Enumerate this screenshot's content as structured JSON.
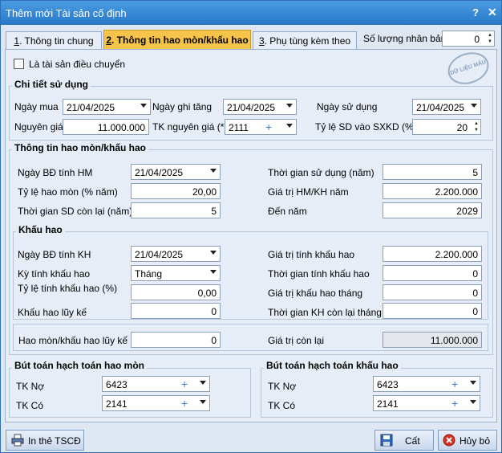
{
  "window": {
    "title": "Thêm mới Tài sản cố định",
    "help_label": "?",
    "close_label": "✕"
  },
  "tabs": [
    {
      "key": "1",
      "rest": ". Thông tin chung"
    },
    {
      "key": "2",
      "rest": ". Thông tin hao mòn/khấu hao"
    },
    {
      "key": "3",
      "rest": ". Phụ tùng kèm theo"
    }
  ],
  "copies": {
    "label": "Số lượng nhân bản",
    "value": "0"
  },
  "transfer_checkbox": {
    "label": "Là tài sản điều chuyển",
    "checked": false
  },
  "stamp": {
    "text": "DỮ LIỆU MẪU"
  },
  "usage": {
    "title": "Chi tiết sử dụng",
    "purchase_date_label": "Ngày mua",
    "purchase_date": "21/04/2025",
    "increase_date_label": "Ngày ghi tăng",
    "increase_date": "21/04/2025",
    "use_date_label": "Ngày sử dụng",
    "use_date": "21/04/2025",
    "cost_label": "Nguyên giá",
    "cost": "11.000.000",
    "cost_account_label": "TK nguyên giá (*)",
    "cost_account": "2111",
    "sxkd_ratio_label": "Tỷ lệ SD vào SXKD (%)",
    "sxkd_ratio": "20"
  },
  "depreciation": {
    "title": "Thông tin hao mòn/khấu hao",
    "hm_start_label": "Ngày BĐ tính HM",
    "hm_start": "21/04/2025",
    "hm_rate_label": "Tỷ lệ hao mòn (% năm)",
    "hm_rate": "20,00",
    "remaining_years_label": "Thời gian SD còn lại (năm)",
    "remaining_years": "5",
    "use_years_label": "Thời gian sử dụng (năm)",
    "use_years": "5",
    "hm_value_label": "Giá trị HM/KH năm",
    "hm_value": "2.200.000",
    "to_year_label": "Đến năm",
    "to_year": "2029"
  },
  "kh": {
    "title": "Khấu hao",
    "start_label": "Ngày BĐ tính KH",
    "start": "21/04/2025",
    "period_label": "Kỳ tính khấu hao",
    "period": "Tháng",
    "rate_label": "Tỷ lệ tính khấu hao (%)",
    "rate": "0,00",
    "accumulated_label": "Khấu hao lũy kế",
    "accumulated": "0",
    "base_label": "Giá trị tính khấu hao",
    "base": "2.200.000",
    "months_label": "Thời gian tính khấu hao",
    "months": "0",
    "monthly_label": "Giá trị khấu hao tháng",
    "monthly": "0",
    "remaining_label": "Thời gian KH còn lại tháng",
    "remaining": "0"
  },
  "summary": {
    "total_label": "Hao mòn/khấu hao lũy kế",
    "total": "0",
    "residual_label": "Giá trị còn lại",
    "residual": "11.000.000"
  },
  "hm_posting": {
    "title": "Bút toán hạch toán hao mòn",
    "debit_label": "TK Nợ",
    "debit": "6423",
    "credit_label": "TK Có",
    "credit": "2141"
  },
  "kh_posting": {
    "title": "Bút toán hạch toán khấu hao",
    "debit_label": "TK Nợ",
    "debit": "6423",
    "credit_label": "TK Có",
    "credit": "2141"
  },
  "buttons": {
    "print": "In thẻ TSCĐ",
    "save": "Cất",
    "cancel": "Hủy bỏ"
  },
  "colors": {
    "title_bar": "#2878c8",
    "active_tab": "#f7c44a"
  }
}
